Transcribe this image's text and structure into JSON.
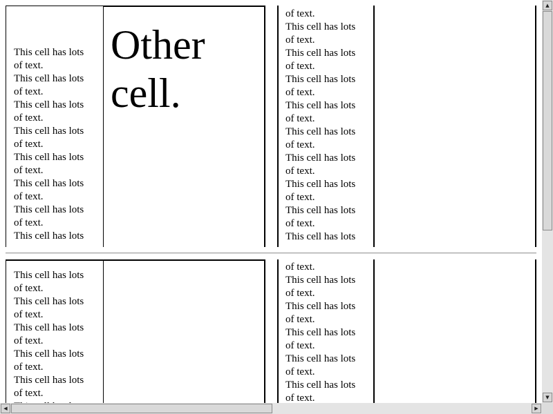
{
  "table1": {
    "cell_a_text": [
      "This cell has lots",
      "of text.",
      "This cell has lots",
      "of text.",
      "This cell has lots",
      "of text.",
      "This cell has lots",
      "of text.",
      "This cell has lots",
      "of text.",
      "This cell has lots",
      "of text.",
      "This cell has lots",
      "of text.",
      "This cell has lots"
    ],
    "cell_b_text": [
      "Other",
      "cell."
    ],
    "cell_c_text": [
      "of text.",
      "This cell has lots",
      "of text.",
      "This cell has lots",
      "of text.",
      "This cell has lots",
      "of text.",
      "This cell has lots",
      "of text.",
      "This cell has lots",
      "of text.",
      "This cell has lots",
      "of text.",
      "This cell has lots",
      "of text.",
      "This cell has lots",
      "of text.",
      "This cell has lots"
    ]
  },
  "table2": {
    "cell_a_text": [
      "This cell has lots",
      "of text.",
      "This cell has lots",
      "of text.",
      "This cell has lots",
      "of text.",
      "This cell has lots",
      "of text.",
      "This cell has lots",
      "of text.",
      "This cell has lots"
    ],
    "cell_c_text": [
      "of text.",
      "This cell has lots",
      "of text.",
      "This cell has lots",
      "of text.",
      "This cell has lots",
      "of text.",
      "This cell has lots",
      "of text.",
      "This cell has lots",
      "of text."
    ]
  },
  "scrollbar": {
    "up_icon": "▲",
    "down_icon": "▼",
    "left_icon": "◀",
    "right_icon": "▶",
    "vertical_position": 0.0,
    "horizontal_position": 0.0
  }
}
